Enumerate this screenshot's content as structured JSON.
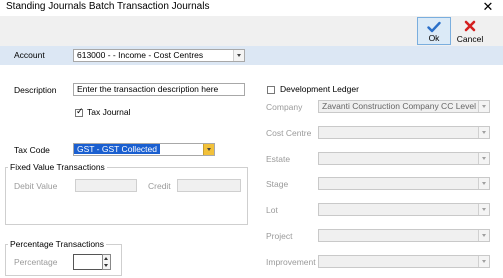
{
  "window": {
    "title": "Standing Journals Batch Transaction Journals",
    "close_glyph": "✕"
  },
  "toolbar": {
    "ok_label": "Ok",
    "ok_icon": "checkmark-icon",
    "cancel_label": "Cancel",
    "cancel_icon": "red-x-icon"
  },
  "account": {
    "label": "Account",
    "value": "613000 -  - Income - Cost Centres"
  },
  "description": {
    "label": "Description",
    "value": "Enter the transaction description here"
  },
  "tax_journal": {
    "label": "Tax Journal",
    "checked": true
  },
  "tax_code": {
    "label": "Tax Code",
    "value": "GST - GST Collected"
  },
  "fixed_value": {
    "title": "Fixed Value Transactions",
    "debit_label": "Debit Value",
    "debit_value": "",
    "credit_label": "Credit",
    "credit_value": ""
  },
  "percentage": {
    "title": "Percentage Transactions",
    "label": "Percentage",
    "value": ""
  },
  "development": {
    "checkbox_label": "Development Ledger",
    "checked": false,
    "fields": [
      {
        "label": "Company",
        "value": "Zavanti Construction Company CC Level"
      },
      {
        "label": "Cost Centre",
        "value": ""
      },
      {
        "label": "Estate",
        "value": ""
      },
      {
        "label": "Stage",
        "value": ""
      },
      {
        "label": "Lot",
        "value": ""
      },
      {
        "label": "Project",
        "value": ""
      },
      {
        "label": "Improvement",
        "value": ""
      }
    ]
  },
  "colors": {
    "account_bar": "#dce7f4",
    "selection": "#1a5fd0",
    "ok_check": "#2a6fc9",
    "cancel_x": "#d42020",
    "combo_button": "#f2c13a"
  }
}
